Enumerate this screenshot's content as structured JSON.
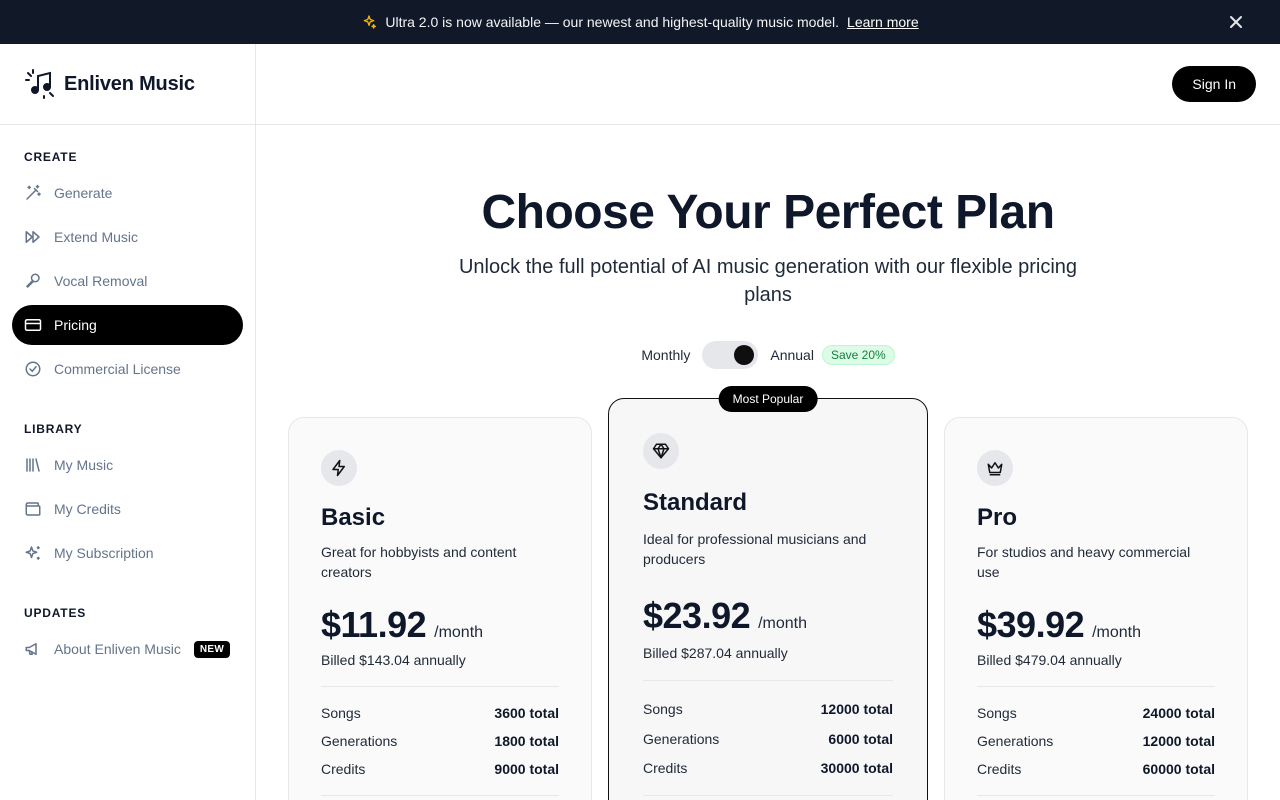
{
  "banner": {
    "icon": "sparkles-icon",
    "message": "Ultra 2.0 is now available — our newest and highest-quality music model.",
    "link": "Learn more"
  },
  "brand": {
    "name": "Enliven Music",
    "logo": "music-notes-logo"
  },
  "header": {
    "sign_in": "Sign In"
  },
  "sidebar": {
    "sections": [
      {
        "title": "CREATE",
        "items": [
          {
            "label": "Generate",
            "icon": "magic-wand-icon"
          },
          {
            "label": "Extend Music",
            "icon": "fast-forward-icon"
          },
          {
            "label": "Vocal Removal",
            "icon": "microphone-icon"
          },
          {
            "label": "Pricing",
            "icon": "credit-card-icon",
            "active": true
          },
          {
            "label": "Commercial License",
            "icon": "check-circle-icon"
          }
        ]
      },
      {
        "title": "LIBRARY",
        "items": [
          {
            "label": "My Music",
            "icon": "library-icon"
          },
          {
            "label": "My Credits",
            "icon": "wallet-icon"
          },
          {
            "label": "My Subscription",
            "icon": "sparkles-icon"
          }
        ]
      },
      {
        "title": "UPDATES",
        "items": [
          {
            "label": "About Enliven Music",
            "icon": "megaphone-icon",
            "badge": "NEW"
          }
        ]
      }
    ]
  },
  "main": {
    "title": "Choose Your Perfect Plan",
    "subtitle": "Unlock the full potential of AI music generation with our flexible pricing plans",
    "billing": {
      "monthly": "Monthly",
      "annual": "Annual",
      "save": "Save 20%",
      "selected": "Annual"
    },
    "plans": [
      {
        "name": "Basic",
        "icon": "lightning-icon",
        "description": "Great for hobbyists and content creators",
        "price": "$11.92",
        "period": "/month",
        "billed": "Billed $143.04 annually",
        "features": [
          {
            "label": "Songs",
            "value": "3600 total"
          },
          {
            "label": "Generations",
            "value": "1800 total"
          },
          {
            "label": "Credits",
            "value": "9000 total"
          }
        ]
      },
      {
        "name": "Standard",
        "icon": "diamond-icon",
        "badge": "Most Popular",
        "description": "Ideal for professional musicians and producers",
        "price": "$23.92",
        "period": "/month",
        "billed": "Billed $287.04 annually",
        "features": [
          {
            "label": "Songs",
            "value": "12000 total"
          },
          {
            "label": "Generations",
            "value": "6000 total"
          },
          {
            "label": "Credits",
            "value": "30000 total"
          }
        ]
      },
      {
        "name": "Pro",
        "icon": "crown-icon",
        "description": "For studios and heavy commercial use",
        "price": "$39.92",
        "period": "/month",
        "billed": "Billed $479.04 annually",
        "features": [
          {
            "label": "Songs",
            "value": "24000 total"
          },
          {
            "label": "Generations",
            "value": "12000 total"
          },
          {
            "label": "Credits",
            "value": "60000 total"
          }
        ]
      }
    ]
  }
}
